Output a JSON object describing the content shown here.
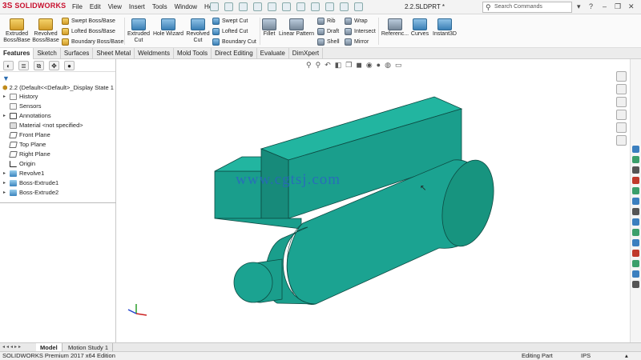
{
  "app": {
    "logo_text": "SOLIDWORKS",
    "logo_prefix": "3S",
    "document_title": "2.2.SLDPRT *"
  },
  "menu": [
    "File",
    "Edit",
    "View",
    "Insert",
    "Tools",
    "Window",
    "Help"
  ],
  "search": {
    "placeholder": "Search Commands"
  },
  "command_manager": {
    "extruded_boss": "Extruded\nBoss/Base",
    "revolved_boss": "Revolved\nBoss/Base",
    "swept_boss": "Swept Boss/Base",
    "lofted_boss": "Lofted Boss/Base",
    "boundary_boss": "Boundary Boss/Base",
    "extruded_cut": "Extruded\nCut",
    "hole_wizard": "Hole Wizard",
    "revolved_cut": "Revolved\nCut",
    "swept_cut": "Swept Cut",
    "lofted_cut": "Lofted Cut",
    "boundary_cut": "Boundary Cut",
    "fillet": "Fillet",
    "linear_pattern": "Linear Pattern",
    "rib": "Rib",
    "draft": "Draft",
    "shell": "Shell",
    "wrap": "Wrap",
    "intersect": "Intersect",
    "mirror": "Mirror",
    "reference": "Referenc...",
    "curves": "Curves",
    "instant3d": "Instant3D"
  },
  "tabs": [
    "Features",
    "Sketch",
    "Surfaces",
    "Sheet Metal",
    "Weldments",
    "Mold Tools",
    "Direct Editing",
    "Evaluate",
    "DimXpert"
  ],
  "feature_tree": {
    "root": "2.2  (Default<<Default>_Display State 1",
    "items": [
      {
        "label": "History",
        "expand": "▸",
        "type": "hist"
      },
      {
        "label": "Sensors",
        "expand": "",
        "type": "hist"
      },
      {
        "label": "Annotations",
        "expand": "▸",
        "type": "ann"
      },
      {
        "label": "Material <not specified>",
        "expand": "",
        "type": "mat"
      },
      {
        "label": "Front Plane",
        "expand": "",
        "type": "plane"
      },
      {
        "label": "Top Plane",
        "expand": "",
        "type": "plane"
      },
      {
        "label": "Right Plane",
        "expand": "",
        "type": "plane"
      },
      {
        "label": "Origin",
        "expand": "",
        "type": "origin"
      },
      {
        "label": "Revolve1",
        "expand": "▸",
        "type": "feat"
      },
      {
        "label": "Boss-Extrude1",
        "expand": "▸",
        "type": "feat"
      },
      {
        "label": "Boss-Extrude2",
        "expand": "▸",
        "type": "feat"
      }
    ]
  },
  "graphics": {
    "watermark": "www.cgtsj.com"
  },
  "bottom_tabs": [
    "Model",
    "Motion Study 1"
  ],
  "status": {
    "edition": "SOLIDWORKS Premium 2017 x64 Edition",
    "mode": "Editing Part",
    "units": "IPS"
  },
  "colors": {
    "part": "#1a9e8c",
    "part_dark": "#127a6c",
    "part_light": "#22b5a0",
    "accent": "#c8102e"
  }
}
